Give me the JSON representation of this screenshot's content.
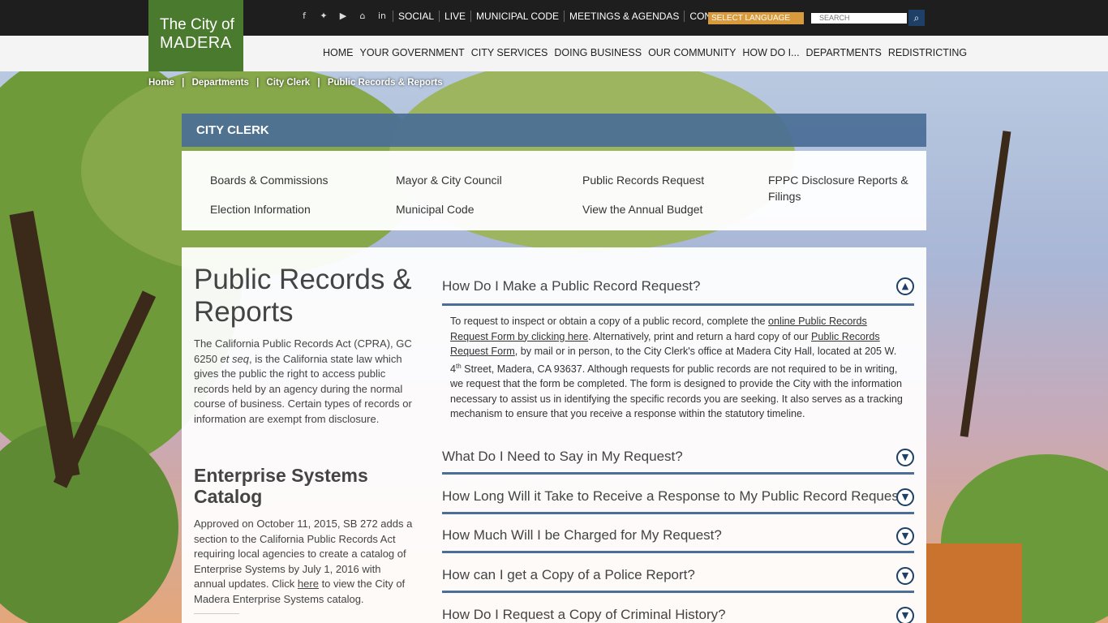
{
  "logo": {
    "line1": "The City of",
    "line2": "MADERA"
  },
  "top_icons": [
    "facebook-icon",
    "twitter-icon",
    "youtube-icon",
    "home-icon",
    "linkedin-icon"
  ],
  "top_links": [
    "SOCIAL",
    "LIVE",
    "MUNICIPAL CODE",
    "MEETINGS & AGENDAS",
    "CONTACT"
  ],
  "language": "SELECT LANGUAGE",
  "search": {
    "placeholder": "SEARCH"
  },
  "main_nav": [
    "HOME",
    "YOUR GOVERNMENT",
    "CITY SERVICES",
    "DOING BUSINESS",
    "OUR COMMUNITY",
    "HOW DO I...",
    "DEPARTMENTS",
    "REDISTRICTING"
  ],
  "breadcrumb": [
    "Home",
    "|",
    "Departments",
    "|",
    "City Clerk",
    "|",
    "Public Records & Reports"
  ],
  "section_title": "CITY CLERK",
  "subnav": [
    "Boards & Commissions",
    "Mayor & City Council",
    "Public Records Request",
    "FPPC Disclosure Reports & Filings",
    "Election Information",
    "Municipal Code",
    "View the Annual Budget"
  ],
  "page": {
    "title": "Public Records & Reports",
    "intro_a": "The California Public Records Act (CPRA), GC 6250 ",
    "intro_em": "et seq",
    "intro_b": ", is the California state law which gives the public the right to access public records held by an agency during the normal course of business. Certain types of records or information are exempt from disclosure.",
    "sub_title": "Enterprise Systems Catalog",
    "sub_a": "Approved on October 11, 2015, SB 272 adds a section to the California Public Records Act requiring local agencies to create a catalog of Enterprise Systems by July 1, 2016 with annual updates.  Click ",
    "sub_link": "here",
    "sub_b": " to view the City of Madera Enterprise Systems catalog."
  },
  "accordion": [
    {
      "q": "How Do I Make a Public Record Request?",
      "open": true
    },
    {
      "q": "What Do I Need to Say in My Request?"
    },
    {
      "q": "How Long Will it Take to Receive a Response to My Public Record Request?"
    },
    {
      "q": "How Much Will I be Charged for My Request?"
    },
    {
      "q": "How can I get a Copy of a Police Report?"
    },
    {
      "q": "How Do I Request a Copy of Criminal History?"
    }
  ],
  "answer": {
    "a1": "To request to inspect or obtain a copy of a public record, complete the ",
    "link1": "online Public Records Request Form by clicking here",
    "a2": ". Alternatively, print and return a hard copy of our ",
    "link2": "Public Records Request Form",
    "a3": ", by mail or in person, to the City Clerk's office at Madera City Hall, located at 205 W. 4",
    "sup": "th",
    "a4": " Street, Madera, CA 93637. Although requests for public records are not required to be in writing, we request that the form be completed. The form is designed to provide the City with the information necessary to assist us in identifying the specific records you are seeking. It also serves as a tracking mechanism to ensure that you receive a response within the statutory timeline."
  }
}
